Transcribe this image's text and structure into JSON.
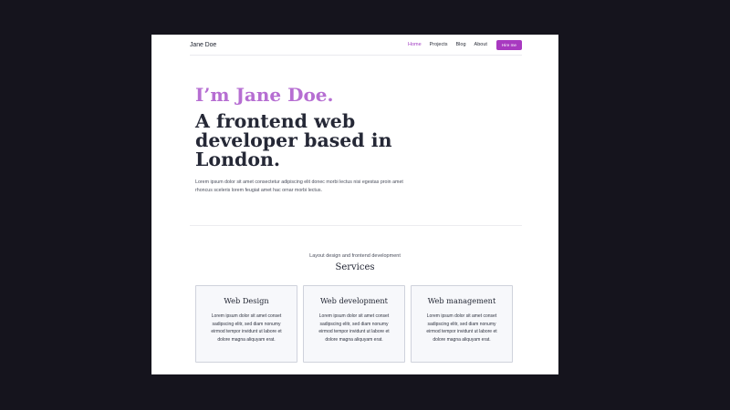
{
  "nav": {
    "brand": "Jane Doe",
    "links": [
      "Home",
      "Projects",
      "Blog",
      "About"
    ],
    "cta": "Hire me"
  },
  "hero": {
    "greeting": "I’m Jane Doe.",
    "headline": "A frontend web developer based in London.",
    "intro": "Lorem ipsum dolor sit amet consectetur adipiscing elit donec morbi lectus nisi egestas proin amet rhoncus sceleris lorem feugiat amet hac ornar morbi lectus."
  },
  "services": {
    "subtitle": "Layout design and frontend development",
    "title": "Services",
    "cards": [
      {
        "title": "Web Design",
        "text": "Lorem ipsum dolor sit amet conset sadipscing elitr, sed diam nonumy eirmod tempor invidunt ut labore et dolore magna aliquyam erat."
      },
      {
        "title": "Web development",
        "text": "Lorem ipsum dolor sit amet conset sadipscing elitr, sed diam nonumy eirmod tempor invidunt ut labore et dolore magna aliquyam erat."
      },
      {
        "title": "Web management",
        "text": "Lorem ipsum dolor sit amet conset sadipscing elitr, sed diam nonumy eirmod tempor invidunt ut labore et dolore magna aliquyam erat."
      }
    ]
  },
  "colors": {
    "background": "#15141d",
    "accent": "#a839c0",
    "greeting": "#b66ed2",
    "heading": "#252836"
  }
}
